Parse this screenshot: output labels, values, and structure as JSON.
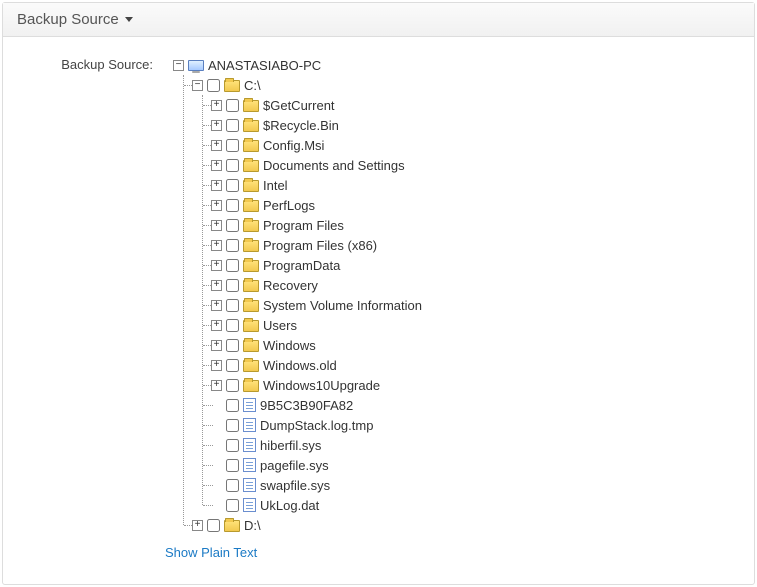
{
  "panel": {
    "title": "Backup Source"
  },
  "field_label": "Backup Source:",
  "show_plain_text": "Show Plain Text",
  "tree": {
    "name": "ANASTASIABO-PC",
    "type": "computer",
    "expanded": true,
    "children": [
      {
        "name": "C:\\",
        "type": "folder",
        "expanded": true,
        "children": [
          {
            "name": "$GetCurrent",
            "type": "folder",
            "expandable": true
          },
          {
            "name": "$Recycle.Bin",
            "type": "folder",
            "expandable": true
          },
          {
            "name": "Config.Msi",
            "type": "folder",
            "expandable": true
          },
          {
            "name": "Documents and Settings",
            "type": "folder",
            "expandable": true
          },
          {
            "name": "Intel",
            "type": "folder",
            "expandable": true
          },
          {
            "name": "PerfLogs",
            "type": "folder",
            "expandable": true
          },
          {
            "name": "Program Files",
            "type": "folder",
            "expandable": true
          },
          {
            "name": "Program Files (x86)",
            "type": "folder",
            "expandable": true
          },
          {
            "name": "ProgramData",
            "type": "folder",
            "expandable": true
          },
          {
            "name": "Recovery",
            "type": "folder",
            "expandable": true
          },
          {
            "name": "System Volume Information",
            "type": "folder",
            "expandable": true
          },
          {
            "name": "Users",
            "type": "folder",
            "expandable": true
          },
          {
            "name": "Windows",
            "type": "folder",
            "expandable": true
          },
          {
            "name": "Windows.old",
            "type": "folder",
            "expandable": true
          },
          {
            "name": "Windows10Upgrade",
            "type": "folder",
            "expandable": true
          },
          {
            "name": "9B5C3B90FA82",
            "type": "file"
          },
          {
            "name": "DumpStack.log.tmp",
            "type": "file"
          },
          {
            "name": "hiberfil.sys",
            "type": "file"
          },
          {
            "name": "pagefile.sys",
            "type": "file"
          },
          {
            "name": "swapfile.sys",
            "type": "file"
          },
          {
            "name": "UkLog.dat",
            "type": "file"
          }
        ]
      },
      {
        "name": "D:\\",
        "type": "folder",
        "expandable": true
      }
    ]
  }
}
